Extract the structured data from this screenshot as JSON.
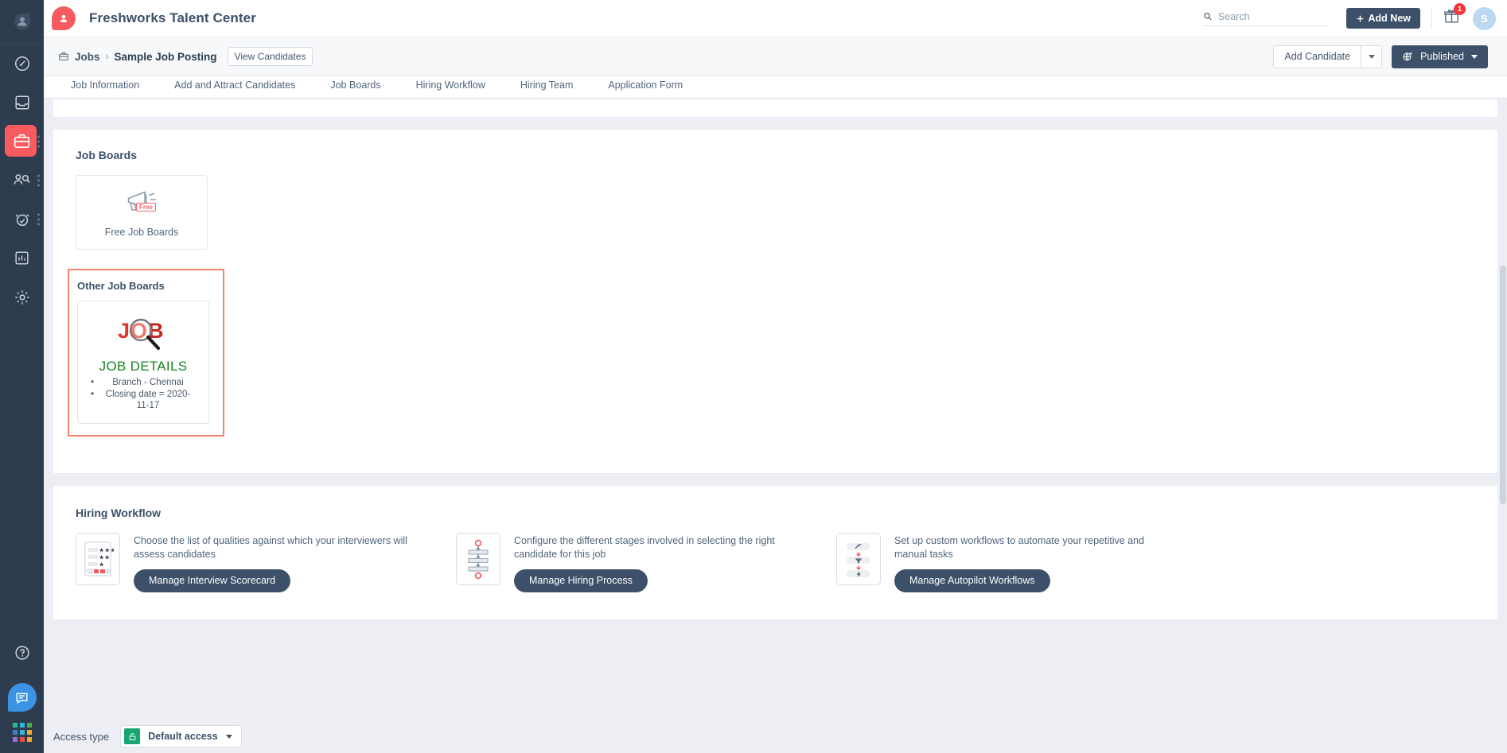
{
  "app": {
    "title": "Freshworks Talent Center",
    "brand_color": "#f75a5f",
    "navy": "#3c5069"
  },
  "rail": {
    "brand_icon": "person-avatar-icon",
    "items": [
      {
        "icon": "speedometer-icon",
        "name": "dashboard",
        "active": false
      },
      {
        "icon": "inbox-icon",
        "name": "inbox",
        "active": false
      },
      {
        "icon": "briefcase-icon",
        "name": "jobs",
        "active": true
      },
      {
        "icon": "people-search-icon",
        "name": "candidates",
        "active": false
      },
      {
        "icon": "alarm-clock-icon",
        "name": "tasks",
        "active": false
      },
      {
        "icon": "bar-chart-icon",
        "name": "reports",
        "active": false
      },
      {
        "icon": "gear-icon",
        "name": "settings",
        "active": false
      }
    ],
    "help_icon": "question-circle-icon",
    "chat_icon": "chat-bubble-icon",
    "grid_icon": "app-switcher-grid-icon"
  },
  "topbar": {
    "search": {
      "placeholder": "Search",
      "value": "",
      "icon": "search-icon"
    },
    "add_new_label": "Add New",
    "add_new_icon": "plus-icon",
    "gift_icon": "gift-icon",
    "gift_badge": "1",
    "avatar_initial": "S"
  },
  "subheader": {
    "breadcrumb": {
      "icon": "briefcase-icon",
      "root": "Jobs",
      "separator": "›",
      "current": "Sample Job Posting"
    },
    "view_candidates_label": "View Candidates",
    "add_candidate_label": "Add Candidate",
    "published_label": "Published",
    "published_icon": "globe-publish-icon"
  },
  "tabs": [
    {
      "label": "Job Information"
    },
    {
      "label": "Add and Attract Candidates"
    },
    {
      "label": "Job Boards"
    },
    {
      "label": "Hiring Workflow"
    },
    {
      "label": "Hiring Team"
    },
    {
      "label": "Application Form"
    }
  ],
  "job_boards": {
    "section_title": "Job Boards",
    "free_tile": {
      "label": "Free Job Boards",
      "icon": "megaphone-icon",
      "badge": "Free"
    },
    "other": {
      "title": "Other Job Boards",
      "highlight_color": "#f5836b",
      "tile": {
        "logo_icon": "job-magnifier-logo",
        "heading": "JOB DETAILS",
        "heading_color": "#1a8521",
        "bullets": [
          "Branch - Chennai",
          "Closing date = 2020-11-17"
        ]
      }
    }
  },
  "hiring_workflow": {
    "section_title": "Hiring Workflow",
    "items": [
      {
        "thumb_icon": "scorecard-stars-icon",
        "description": "Choose the list of qualities against which your interviewers will assess candidates",
        "button_label": "Manage Interview Scorecard"
      },
      {
        "thumb_icon": "pipeline-stages-icon",
        "description": "Configure the different stages involved in selecting the right candidate for this job",
        "button_label": "Manage Hiring Process"
      },
      {
        "thumb_icon": "automation-flow-icon",
        "description": "Set up custom workflows to automate your repetitive and manual tasks",
        "button_label": "Manage Autopilot Workflows"
      }
    ]
  },
  "footer": {
    "access_type_label": "Access type",
    "access_value": "Default access",
    "lock_icon": "unlock-icon",
    "lock_color": "#17a672"
  }
}
